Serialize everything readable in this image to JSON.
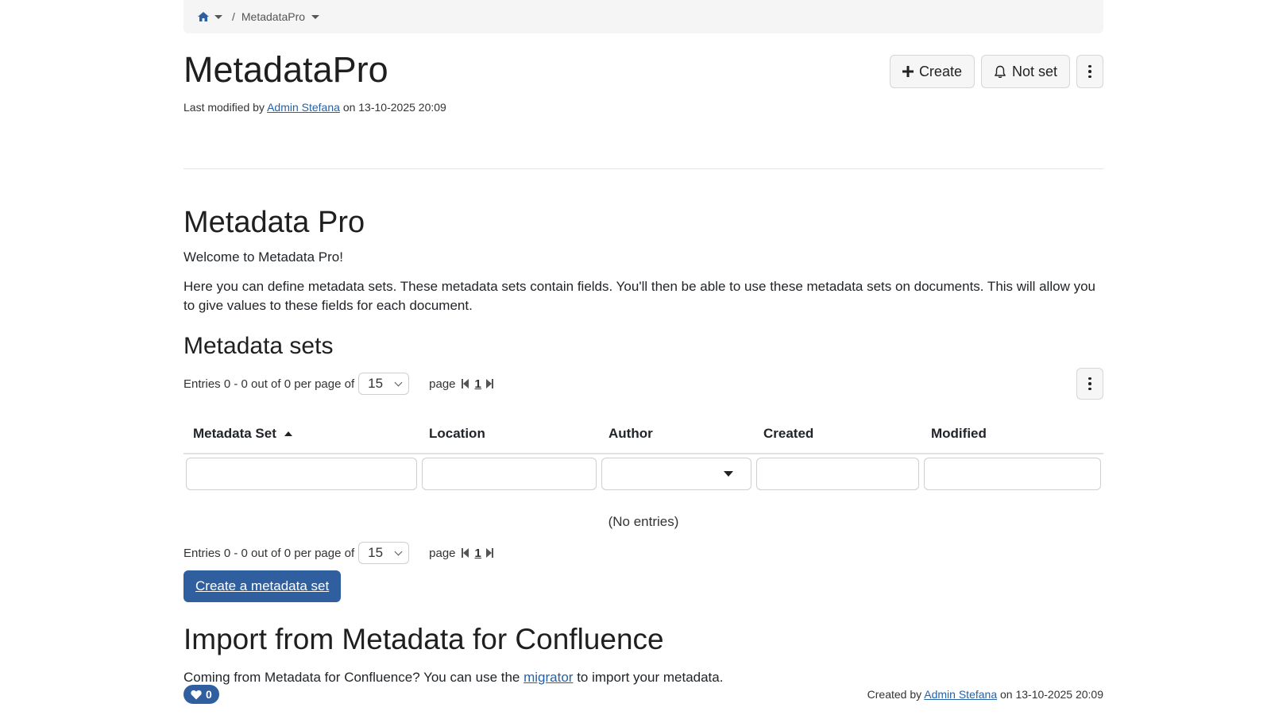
{
  "breadcrumb": {
    "separator": "/",
    "current": "MetadataPro"
  },
  "header": {
    "title": "MetadataPro",
    "last_modified_prefix": "Last modified by",
    "last_modified_user": "Admin Stefana",
    "last_modified_on": "on 13-10-2025 20:09",
    "create_label": "Create",
    "watch_label": "Not set"
  },
  "content": {
    "heading": "Metadata Pro",
    "welcome": "Welcome to Metadata Pro!",
    "description": "Here you can define metadata sets. These metadata sets contain fields. You'll then be able to use these metadata sets on documents. This will allow you to give values to these fields for each document.",
    "sets_heading": "Metadata sets"
  },
  "pager": {
    "entries_text": "Entries 0 - 0 out of 0 per page of",
    "per_page": "15",
    "page_label": "page",
    "page_number": "1"
  },
  "table": {
    "columns": [
      "Metadata Set",
      "Location",
      "Author",
      "Created",
      "Modified"
    ],
    "empty_text": "(No entries)"
  },
  "create_set_button": "Create a metadata set",
  "import": {
    "heading": "Import from Metadata for Confluence",
    "text_before": "Coming from Metadata for Confluence? You can use the",
    "link": "migrator",
    "text_after": "to import your metadata."
  },
  "footer": {
    "likes": "0",
    "created_prefix": "Created by",
    "created_user": "Admin Stefana",
    "created_on": "on 13-10-2025 20:09"
  },
  "colors": {
    "primary": "#2f5f9e",
    "link": "#2463a8"
  }
}
